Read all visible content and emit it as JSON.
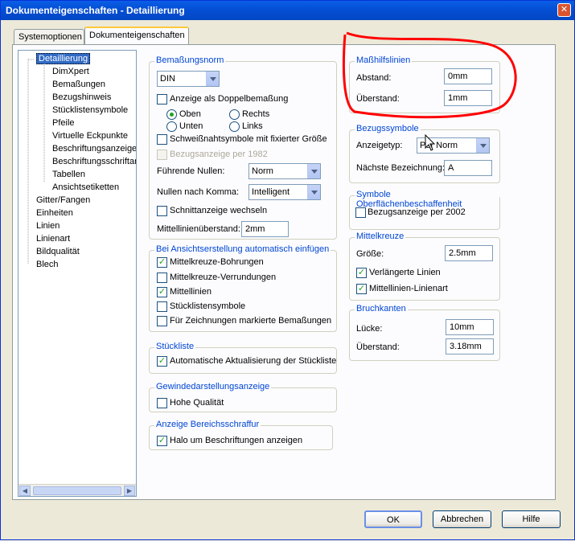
{
  "window": {
    "title": "Dokumenteigenschaften - Detaillierung",
    "close_glyph": "✕"
  },
  "tabs": [
    {
      "label": "Systemoptionen",
      "active": false
    },
    {
      "label": "Dokumenteigenschaften",
      "active": true
    }
  ],
  "tree": {
    "items": [
      {
        "label": "Detaillierung",
        "selected": true,
        "level": 0
      },
      {
        "label": "DimXpert",
        "level": 1
      },
      {
        "label": "Bemaßungen",
        "level": 1
      },
      {
        "label": "Bezugshinweis",
        "level": 1
      },
      {
        "label": "Stücklistensymbole",
        "level": 1
      },
      {
        "label": "Pfeile",
        "level": 1
      },
      {
        "label": "Virtuelle Eckpunkte",
        "level": 1
      },
      {
        "label": "Beschriftungsanzeige",
        "level": 1
      },
      {
        "label": "Beschriftungsschriftart",
        "level": 1
      },
      {
        "label": "Tabellen",
        "level": 1
      },
      {
        "label": "Ansichtsetiketten",
        "level": 1
      },
      {
        "label": "Gitter/Fangen",
        "level": 0
      },
      {
        "label": "Einheiten",
        "level": 0
      },
      {
        "label": "Linien",
        "level": 0
      },
      {
        "label": "Linienart",
        "level": 0
      },
      {
        "label": "Bildqualität",
        "level": 0
      },
      {
        "label": "Blech",
        "level": 0
      }
    ]
  },
  "bemassungsnorm": {
    "title": "Bemaßungsnorm",
    "norm_value": "DIN",
    "doppel_label": "Anzeige als Doppelbemaßung",
    "oben": "Oben",
    "rechts": "Rechts",
    "unten": "Unten",
    "links": "Links",
    "schweiss_label": "Schweißnahtsymbole mit fixierter Größe",
    "bezug1982_label": "Bezugsanzeige per 1982",
    "fuehrende_label": "Führende Nullen:",
    "fuehrende_value": "Norm",
    "nullen_label": "Nullen nach Komma:",
    "nullen_value": "Intelligent",
    "schnitt_label": "Schnittanzeige wechseln",
    "mittellinie_label": "Mittellinienüberstand:",
    "mittellinie_value": "2mm"
  },
  "ansicht": {
    "title": "Bei Ansichtserstellung automatisch einfügen",
    "items": [
      {
        "label": "Mittelkreuze-Bohrungen",
        "checked": true
      },
      {
        "label": "Mittelkreuze-Verrundungen",
        "checked": false
      },
      {
        "label": "Mittellinien",
        "checked": true
      },
      {
        "label": "Stücklistensymbole",
        "checked": false
      },
      {
        "label": "Für Zeichnungen markierte Bemaßungen",
        "checked": false
      }
    ]
  },
  "stueckliste": {
    "title": "Stückliste",
    "auto_label": "Automatische Aktualisierung der Stückliste"
  },
  "gewinde": {
    "title": "Gewindedarstellungsanzeige",
    "hohe_label": "Hohe Qualität"
  },
  "bereich": {
    "title": "Anzeige Bereichsschraffur",
    "halo_label": "Halo um Beschriftungen anzeigen"
  },
  "masshilfslinien": {
    "title": "Maßhilfslinien",
    "abstand_label": "Abstand:",
    "abstand_value": "0mm",
    "ueberstand_label": "Überstand:",
    "ueberstand_value": "1mm"
  },
  "bezugssymbole": {
    "title": "Bezugssymbole",
    "anzeigetyp_label": "Anzeigetyp:",
    "anzeigetyp_value": "Per Norm",
    "naechste_label": "Nächste Bezeichnung:",
    "naechste_value": "A"
  },
  "oberflaeche": {
    "title": "Symbole Oberflächenbeschaffenheit",
    "bezug2002_label": "Bezugsanzeige per 2002"
  },
  "mittelkreuze": {
    "title": "Mittelkreuze",
    "groesse_label": "Größe:",
    "groesse_value": "2.5mm",
    "verl_label": "Verlängerte Linien",
    "mittellinienart_label": "Mittellinien-Linienart"
  },
  "bruchkanten": {
    "title": "Bruchkanten",
    "luecke_label": "Lücke:",
    "luecke_value": "10mm",
    "ueberstand_label": "Überstand:",
    "ueberstand_value": "3.18mm"
  },
  "buttons": {
    "ok": "OK",
    "cancel": "Abbrechen",
    "help": "Hilfe"
  },
  "colors": {
    "annotation": "#ff0000",
    "titlebar": "#0450d6",
    "accent_text": "#0046d5"
  }
}
